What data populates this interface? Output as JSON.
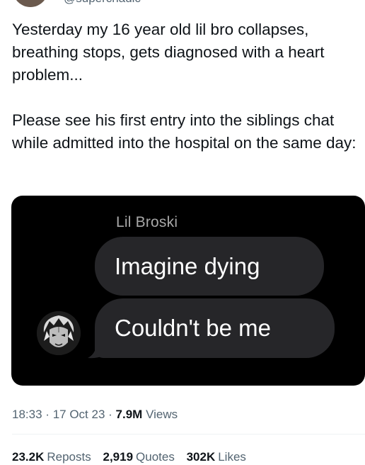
{
  "author": {
    "handle": "@superchadic"
  },
  "tweet": {
    "paragraph_1": "Yesterday my 16 year old lil bro collapses, breathing stops, gets diagnosed with a heart problem...",
    "paragraph_2": "Please see his first entry into the siblings chat while admitted into the hospital on the same day:"
  },
  "chat": {
    "sender": "Lil Broski",
    "messages": [
      "Imagine dying",
      "Couldn't be me"
    ]
  },
  "meta": {
    "time": "18:33",
    "date": "17 Oct 23",
    "views_count": "7.9M",
    "views_label": "Views",
    "separator": "·"
  },
  "stats": {
    "reposts_count": "23.2K",
    "reposts_label": "Reposts",
    "quotes_count": "2,919",
    "quotes_label": "Quotes",
    "likes_count": "302K",
    "likes_label": "Likes"
  },
  "colors": {
    "text": "#0f1419",
    "muted": "#536471",
    "bubble": "#262629",
    "media_bg": "#000000"
  }
}
